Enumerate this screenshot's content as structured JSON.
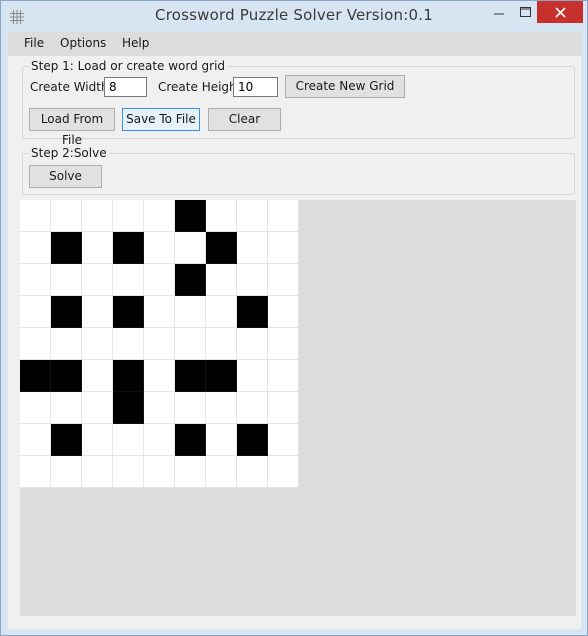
{
  "window": {
    "title": "Crossword Puzzle Solver Version:0.1"
  },
  "menu": {
    "items": [
      "File",
      "Options",
      "Help"
    ]
  },
  "step1": {
    "legend": "Step 1: Load or create word grid",
    "width_label": "Create Width:",
    "width_value": "8",
    "height_label": "Create Height:",
    "height_value": "10",
    "create_button": "Create New Grid",
    "load_button": "Load From File",
    "save_button": "Save To File",
    "clear_button": "Clear"
  },
  "step2": {
    "legend": "Step 2:Solve",
    "solve_button": "Solve"
  },
  "grid": {
    "rows": [
      "00000100",
      "01010010",
      "00000100",
      "01010001",
      "00000000",
      "11010110",
      "00010000",
      "01000101",
      "00000000"
    ]
  },
  "colors": {
    "black_cell": "#000000",
    "white_cell": "#ffffff",
    "close_button": "#c7302b"
  }
}
